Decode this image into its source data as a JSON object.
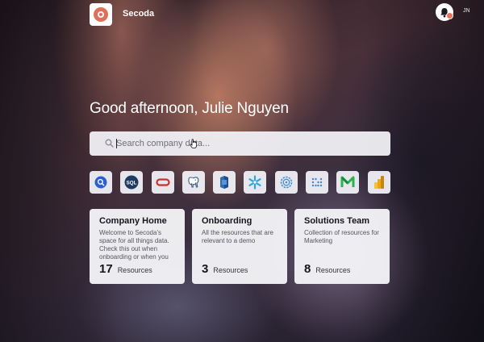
{
  "app": {
    "name": "Secoda"
  },
  "user": {
    "initials": "JN"
  },
  "greeting": "Good afternoon, Julie Nguyen",
  "search": {
    "placeholder": "Search company data..."
  },
  "integrations": [
    {
      "name": "search-integration",
      "icon": "magnify-circle-icon"
    },
    {
      "name": "sql-integration",
      "icon": "sql-icon",
      "label": "SQL"
    },
    {
      "name": "oracle-integration",
      "icon": "oracle-icon"
    },
    {
      "name": "postgres-integration",
      "icon": "elephant-icon"
    },
    {
      "name": "redshift-integration",
      "icon": "cylinder-icon"
    },
    {
      "name": "snowflake-integration",
      "icon": "snowflake-icon"
    },
    {
      "name": "dbt-integration",
      "icon": "ring-icon"
    },
    {
      "name": "grid-integration",
      "icon": "dot-grid-icon"
    },
    {
      "name": "metabase-integration",
      "icon": "m-logo-icon"
    },
    {
      "name": "powerbi-integration",
      "icon": "bars-icon"
    }
  ],
  "cards": [
    {
      "title": "Company Home",
      "description": "Welcome to Secoda's space for all things data. Check this out when onboarding or when you",
      "count": "17",
      "unit": "Resources"
    },
    {
      "title": "Onboarding",
      "description": "All the resources that are relevant to a demo",
      "count": "3",
      "unit": "Resources"
    },
    {
      "title": "Solutions Team",
      "description": "Collection of resources for Marketing",
      "count": "8",
      "unit": "Resources"
    }
  ],
  "colors": {
    "accent": "#e0705a",
    "notification": "#e8735f",
    "card_bg": "#f4f4f7"
  }
}
